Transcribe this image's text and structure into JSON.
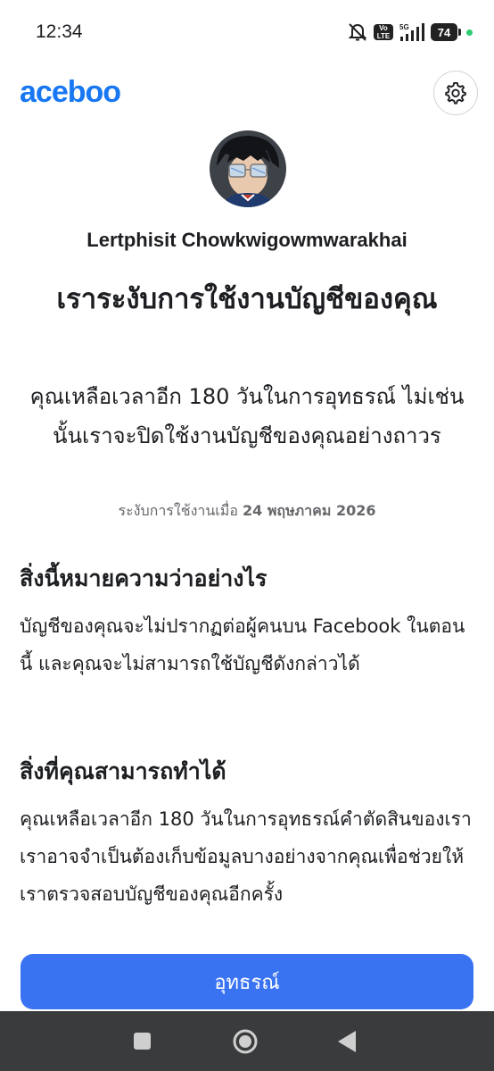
{
  "status_bar": {
    "time": "12:34",
    "volte_label": "Vo LTE",
    "network": "5G",
    "battery": "74"
  },
  "header": {
    "brand_text": "aceboo",
    "brand_color": "#1877f2",
    "settings_icon": "gear-icon"
  },
  "profile": {
    "avatar": "profile-photo",
    "name": "Lertphisit Chowkwigowmwarakhai"
  },
  "notice": {
    "title": "เราระงับการใช้งานบัญชีของคุณ",
    "subtitle": "คุณเหลือเวลาอีก 180 วันในการอุทธรณ์ ไม่เช่นนั้นเราจะปิดใช้งานบัญชีของคุณอย่างถาวร",
    "suspended_label": "ระงับการใช้งานเมื่อ",
    "suspended_date": "24 พฤษภาคม  2026"
  },
  "sections": [
    {
      "heading": "สิ่งนี้หมายความว่าอย่างไร",
      "body": "บัญชีของคุณจะไม่ปรากฏต่อผู้คนบน Facebook ในตอนนี้ และคุณจะไม่สามารถใช้บัญชีดังกล่าวได้"
    },
    {
      "heading": "สิ่งที่คุณสามารถทำได้",
      "body": "คุณเหลือเวลาอีก 180 วันในการอุทธรณ์คำตัดสินของเรา เราอาจจำเป็นต้องเก็บข้อมูลบางอย่างจากคุณเพื่อช่วยให้เราตรวจสอบบัญชีของคุณอีกครั้ง"
    }
  ],
  "actions": {
    "appeal_label": "อุทธรณ์",
    "appeal_color": "#3a73f2"
  },
  "nav_bar": {
    "recents_icon": "square-icon",
    "home_icon": "circle-home-icon",
    "back_icon": "triangle-back-icon"
  }
}
